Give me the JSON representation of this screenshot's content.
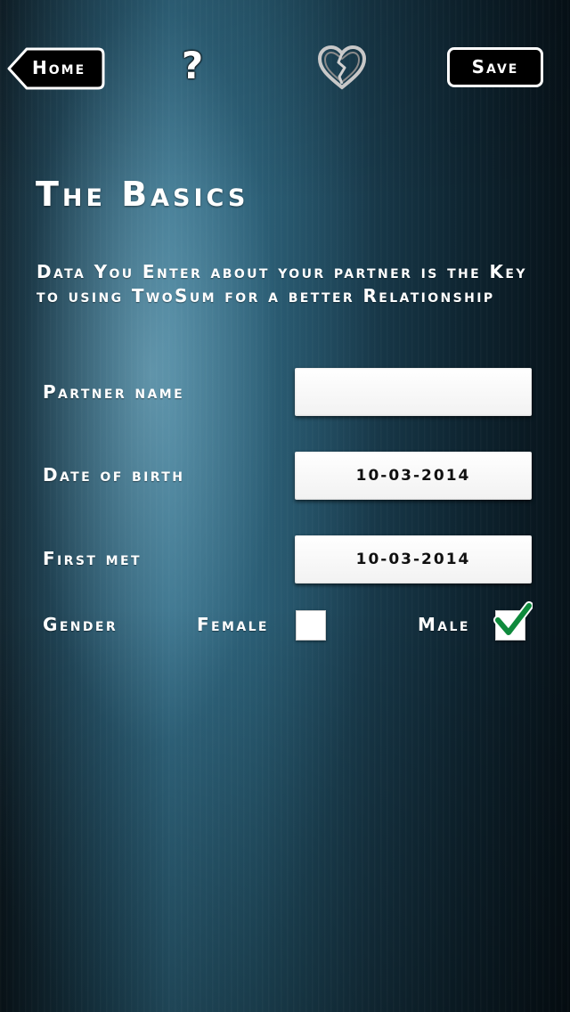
{
  "header": {
    "home_label": "Home",
    "help_glyph": "?",
    "save_label": "Save",
    "icons": [
      "back-arrow-icon",
      "question-mark-icon",
      "broken-heart-icon"
    ]
  },
  "main": {
    "title": "The Basics",
    "intro": "Data You Enter about your partner is the Key to using TwoSum for a better Relationship",
    "fields": [
      {
        "label": "Partner name",
        "value": ""
      },
      {
        "label": "Date of birth",
        "value": "10-03-2014"
      },
      {
        "label": "First met",
        "value": "10-03-2014"
      }
    ],
    "gender": {
      "label": "Gender",
      "options": [
        {
          "label": "Female",
          "checked": false
        },
        {
          "label": "Male",
          "checked": true
        }
      ]
    }
  },
  "colors": {
    "background_dark": "#0c1a22",
    "background_teal": "#2f6a84",
    "check_green": "#0f8a3c",
    "button_black": "#000000",
    "text_white": "#ffffff"
  }
}
